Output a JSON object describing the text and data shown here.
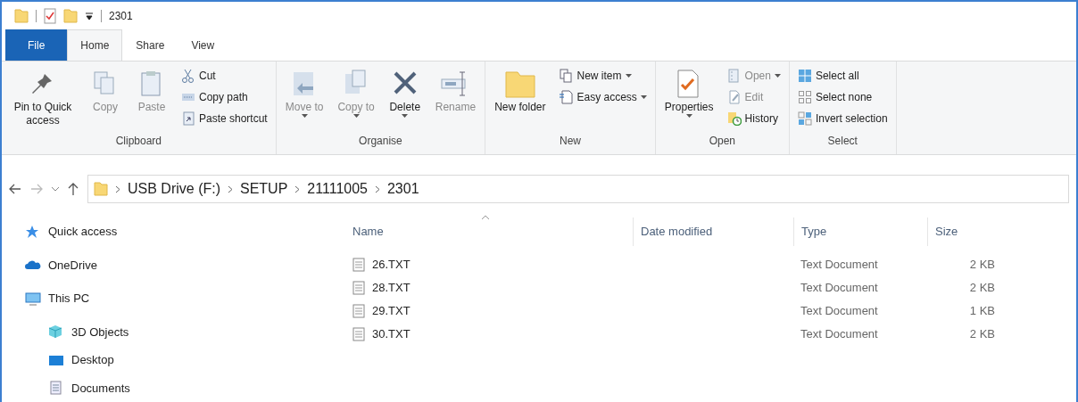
{
  "window": {
    "title": "2301"
  },
  "tabs": [
    {
      "label": "File",
      "selected": false,
      "kind": "file"
    },
    {
      "label": "Home",
      "selected": true,
      "kind": "tab"
    },
    {
      "label": "Share",
      "selected": false,
      "kind": "tab"
    },
    {
      "label": "View",
      "selected": false,
      "kind": "tab"
    }
  ],
  "ribbon": [
    {
      "label": "Clipboard",
      "items": [
        {
          "label": "Pin to Quick access",
          "kind": "large",
          "disabled": false,
          "dropdown": false
        },
        {
          "label": "Copy",
          "kind": "large",
          "disabled": true,
          "dropdown": false
        },
        {
          "label": "Paste",
          "kind": "large",
          "disabled": true,
          "dropdown": false
        },
        {
          "kind": "stack",
          "items": [
            {
              "label": "Cut",
              "disabled": false,
              "dropdown": false
            },
            {
              "label": "Copy path",
              "disabled": false,
              "dropdown": false
            },
            {
              "label": "Paste shortcut",
              "disabled": false,
              "dropdown": false
            }
          ]
        }
      ]
    },
    {
      "label": "Organise",
      "items": [
        {
          "label": "Move to",
          "kind": "large",
          "disabled": true,
          "dropdown": true
        },
        {
          "label": "Copy to",
          "kind": "large",
          "disabled": true,
          "dropdown": true
        },
        {
          "label": "Delete",
          "kind": "large",
          "disabled": false,
          "dropdown": true
        },
        {
          "label": "Rename",
          "kind": "large",
          "disabled": true,
          "dropdown": false
        }
      ]
    },
    {
      "label": "New",
      "items": [
        {
          "label": "New folder",
          "kind": "large",
          "disabled": false,
          "dropdown": false
        },
        {
          "kind": "stack",
          "items": [
            {
              "label": "New item",
              "disabled": false,
              "dropdown": true
            },
            {
              "label": "Easy access",
              "disabled": false,
              "dropdown": true
            }
          ]
        }
      ]
    },
    {
      "label": "Open",
      "items": [
        {
          "label": "Properties",
          "kind": "large",
          "disabled": false,
          "dropdown": true
        },
        {
          "kind": "stack",
          "items": [
            {
              "label": "Open",
              "disabled": true,
              "dropdown": true
            },
            {
              "label": "Edit",
              "disabled": true,
              "dropdown": false
            },
            {
              "label": "History",
              "disabled": false,
              "dropdown": false
            }
          ]
        }
      ]
    },
    {
      "label": "Select",
      "items": [
        {
          "kind": "stack",
          "items": [
            {
              "label": "Select all",
              "disabled": false,
              "dropdown": false
            },
            {
              "label": "Select none",
              "disabled": false,
              "dropdown": false
            },
            {
              "label": "Invert selection",
              "disabled": false,
              "dropdown": false
            }
          ]
        }
      ]
    }
  ],
  "address": {
    "path": [
      "USB Drive (F:)",
      "SETUP",
      "21111005",
      "2301"
    ]
  },
  "sidebar": {
    "items": [
      {
        "label": "Quick access",
        "kind": "star"
      },
      {
        "label": "OneDrive",
        "kind": "cloud"
      },
      {
        "label": "This PC",
        "kind": "pc",
        "children": [
          {
            "label": "3D Objects",
            "kind": "cube"
          },
          {
            "label": "Desktop",
            "kind": "desktop"
          },
          {
            "label": "Documents",
            "kind": "doc"
          }
        ]
      }
    ]
  },
  "table": {
    "columns": [
      "Name",
      "Date modified",
      "Type",
      "Size"
    ],
    "rows": [
      {
        "name": "26.TXT",
        "type": "Text Document",
        "size": "2 KB"
      },
      {
        "name": "28.TXT",
        "type": "Text Document",
        "size": "2 KB"
      },
      {
        "name": "29.TXT",
        "type": "Text Document",
        "size": "1 KB"
      },
      {
        "name": "30.TXT",
        "type": "Text Document",
        "size": "2 KB"
      }
    ]
  }
}
